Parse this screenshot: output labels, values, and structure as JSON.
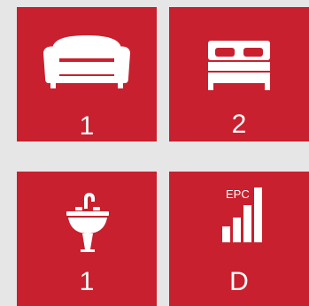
{
  "tiles": [
    {
      "name": "reception-rooms",
      "icon": "sofa-icon",
      "value": "1"
    },
    {
      "name": "bedrooms",
      "icon": "bed-icon",
      "value": "2"
    },
    {
      "name": "bathrooms",
      "icon": "sink-icon",
      "value": "1"
    },
    {
      "name": "epc-rating",
      "icon": "epc-signal-icon",
      "icon_label": "EPC",
      "value": "D"
    }
  ],
  "colors": {
    "tile": "#c8202e",
    "background": "#e6e6e6",
    "foreground": "#ffffff"
  }
}
